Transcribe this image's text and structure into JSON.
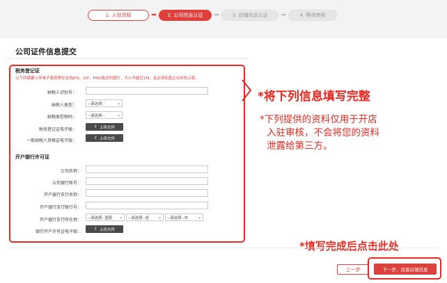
{
  "steps": [
    {
      "label": "1. 入驻须知",
      "state": "done"
    },
    {
      "label": "2. 公司信息认证",
      "state": "active"
    },
    {
      "label": "3. 店铺信息认证",
      "state": "todo"
    },
    {
      "label": "4. 等待审核",
      "state": "todo"
    }
  ],
  "arrow_glyph": "➡",
  "page_title": "公司证件信息提交",
  "tax_section": {
    "title": "税务登记证",
    "hint": "以下所需要上传电子版资质仅支持JPG、GIF、PNG格式的图片，大小不超过1M，且必须加盖企业彩色公章。",
    "taxpayer_id_label": "纳税人识别号：",
    "taxpayer_type_label": "纳税人类型：",
    "taxpayer_type_value": "--请选择--",
    "tax_code_label": "纳税类型税码：",
    "tax_code_value": "--请选择--",
    "tax_cert_label": "税务登记证电子版：",
    "general_taxpayer_label": "一般纳税人资格证电子版："
  },
  "upload_label": "上传文件",
  "bank_section": {
    "title": "开户银行许可证",
    "company_name_label": "公司名称：",
    "company_account_label": "公司银行账号：",
    "branch_name_label": "开户银行支行名称：",
    "branch_code_label": "开户银行支行联行号：",
    "branch_location_label": "开户银行支行所在地：",
    "country_value": "--请选择--国家",
    "province_value": "--请选择--省",
    "city_value": "--请选择--市",
    "license_label": "银行开户许可证电子版："
  },
  "annotations": {
    "main": "*将下列信息填写完整",
    "note_lines": [
      "*下列提供的资料仅用于开店",
      "入驻审核，不会将您的资料",
      "泄露给第三方。"
    ],
    "bottom": "*填写完成后点击此处"
  },
  "buttons": {
    "prev": "上一步",
    "next": "下一步，完善店铺信息"
  },
  "colors": {
    "accent": "#e0403c",
    "annotation_red": "#e8281e"
  }
}
